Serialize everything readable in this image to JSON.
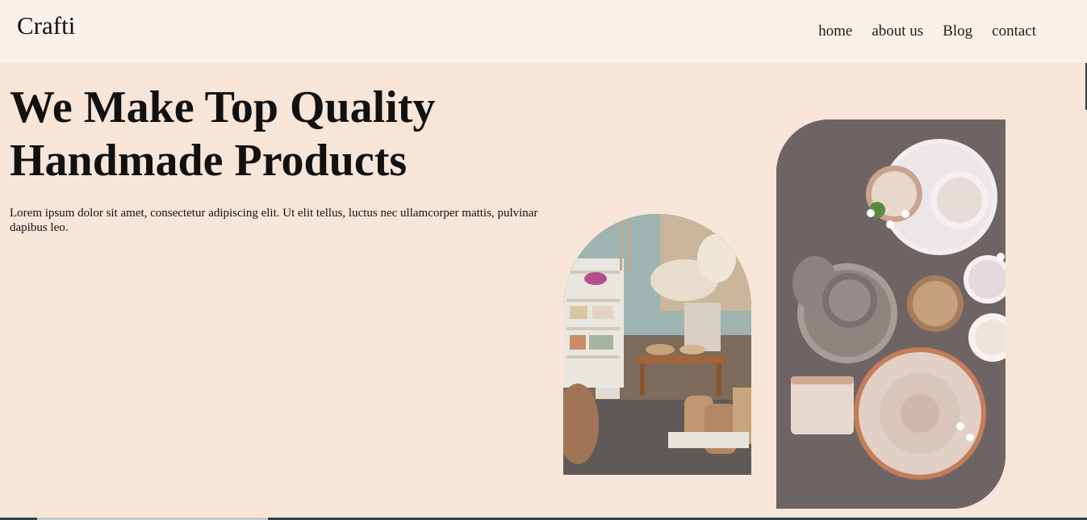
{
  "brand": {
    "name": "Crafti"
  },
  "nav": {
    "items": [
      "home",
      "about us",
      "Blog",
      "contact"
    ]
  },
  "hero": {
    "title_line1": "We Make Top Quality",
    "title_line2": "Handmade Products",
    "description": "Lorem ipsum dolor sit amet, consectetur adipiscing elit. Ut elit tellus, luctus nec ullamcorper mattis, pulvinar dapibus leo."
  },
  "colors": {
    "page_bg": "#f7e5d8",
    "navbar_bg": "#f7f0eb",
    "text": "#111111"
  }
}
